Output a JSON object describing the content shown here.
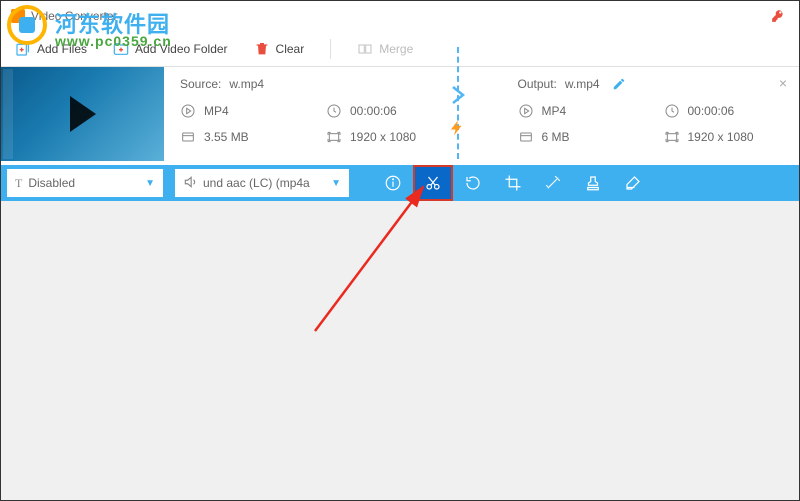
{
  "title": "Video Converter",
  "toolbar": {
    "add_files": "Add Files",
    "add_folder": "Add Video Folder",
    "clear": "Clear",
    "merge": "Merge"
  },
  "source": {
    "label": "Source:",
    "name": "w.mp4",
    "format": "MP4",
    "duration": "00:00:06",
    "size": "3.55 MB",
    "resolution": "1920 x 1080"
  },
  "output": {
    "label": "Output:",
    "name": "w.mp4",
    "format": "MP4",
    "duration": "00:00:06",
    "size": "6 MB",
    "resolution": "1920 x 1080"
  },
  "dropdowns": {
    "subtitle": "Disabled",
    "audio": "und aac (LC) (mp4a"
  },
  "watermark": {
    "site_cn": "河东软件园",
    "site_url": "www.pc0359.cn"
  }
}
